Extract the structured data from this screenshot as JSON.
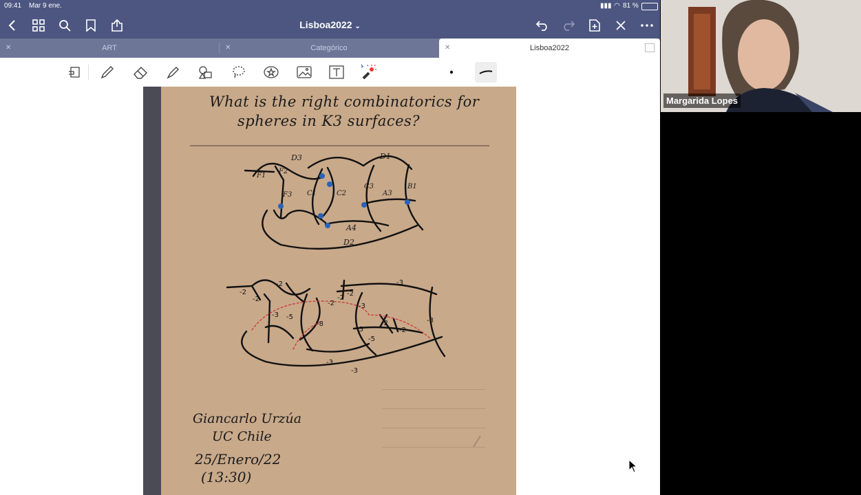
{
  "status": {
    "time": "09:41",
    "date": "Mar 9 ene.",
    "battery": "81 %"
  },
  "titlebar": {
    "doc_title": "Lisboa2022",
    "chevron": "⌄"
  },
  "tabs": [
    {
      "label": "ART",
      "active": false
    },
    {
      "label": "Categórico",
      "active": false
    },
    {
      "label": "Lisboa2022",
      "active": true
    }
  ],
  "note": {
    "heading_line1": "What is the right combinatorics for",
    "heading_line2": "spheres in K3 surfaces?",
    "diagram1_labels": [
      "D3",
      "D1",
      "F1",
      "F2",
      "F3",
      "C1",
      "C2",
      "C3",
      "A3",
      "B1",
      "A4",
      "D2"
    ],
    "diagram2_labels": [
      "-2",
      "-2",
      "-2",
      "-2",
      "-3",
      "-5",
      "-8",
      "-2",
      "-2",
      "-3",
      "-3",
      "-5",
      "-5",
      "-2",
      "-2",
      "-3",
      "-3",
      "-3",
      "-3"
    ],
    "author_line1": "Giancarlo Urzúa",
    "author_line2": "UC Chile",
    "date_line1": "25/Enero/22",
    "date_line2": "(13:30)"
  },
  "participant": {
    "name": "Margarida Lopes"
  },
  "colors": {
    "accent": "#4c5680",
    "paper": "#c8a98a",
    "annotation_red": "#d03030",
    "point_blue": "#2a62b8"
  }
}
